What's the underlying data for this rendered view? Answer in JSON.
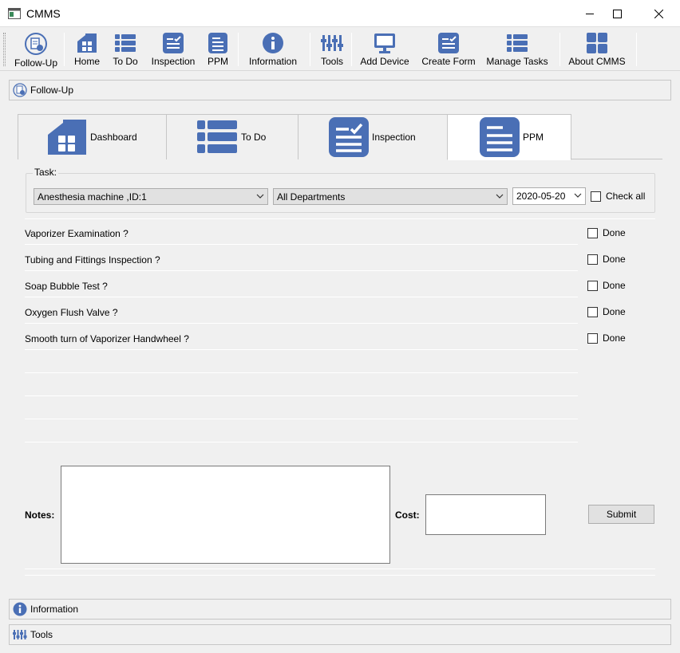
{
  "window": {
    "title": "CMMS"
  },
  "toolbar": {
    "items": [
      {
        "label": "Follow-Up",
        "icon": "follow-up-icon"
      },
      {
        "label": "Home",
        "icon": "home-icon"
      },
      {
        "label": "To Do",
        "icon": "list-icon"
      },
      {
        "label": "Inspection",
        "icon": "checklist-icon"
      },
      {
        "label": "PPM",
        "icon": "document-icon"
      },
      {
        "label": "Information",
        "icon": "info-icon"
      },
      {
        "label": "Tools",
        "icon": "tools-icon"
      },
      {
        "label": "Add Device",
        "icon": "monitor-icon"
      },
      {
        "label": "Create Form",
        "icon": "form-icon"
      },
      {
        "label": "Manage Tasks",
        "icon": "list-icon"
      },
      {
        "label": "About CMMS",
        "icon": "grid-icon"
      }
    ]
  },
  "sections": {
    "follow_up": "Follow-Up",
    "information": "Information",
    "tools": "Tools"
  },
  "tabs": [
    {
      "label": "Dashboard",
      "active": false
    },
    {
      "label": "To Do",
      "active": false
    },
    {
      "label": "Inspection",
      "active": false
    },
    {
      "label": "PPM",
      "active": true
    }
  ],
  "task": {
    "legend": "Task:",
    "device": "Anesthesia machine ,ID:1",
    "department": "All Departments",
    "date": "2020-05-20",
    "check_all": "Check all"
  },
  "checklist": [
    {
      "label": "Vaporizer Examination  ?",
      "done_label": "Done",
      "done": false
    },
    {
      "label": "Tubing and Fittings Inspection  ?",
      "done_label": "Done",
      "done": false
    },
    {
      "label": "Soap Bubble Test  ?",
      "done_label": "Done",
      "done": false
    },
    {
      "label": "Oxygen Flush Valve  ?",
      "done_label": "Done",
      "done": false
    },
    {
      "label": "Smooth turn of Vaporizer Handwheel  ?",
      "done_label": "Done",
      "done": false
    }
  ],
  "form": {
    "notes_label": "Notes:",
    "notes_value": "",
    "cost_label": "Cost:",
    "cost_value": "",
    "submit_label": "Submit"
  },
  "colors": {
    "accent": "#4a6fb5",
    "background": "#f0f0f0"
  }
}
